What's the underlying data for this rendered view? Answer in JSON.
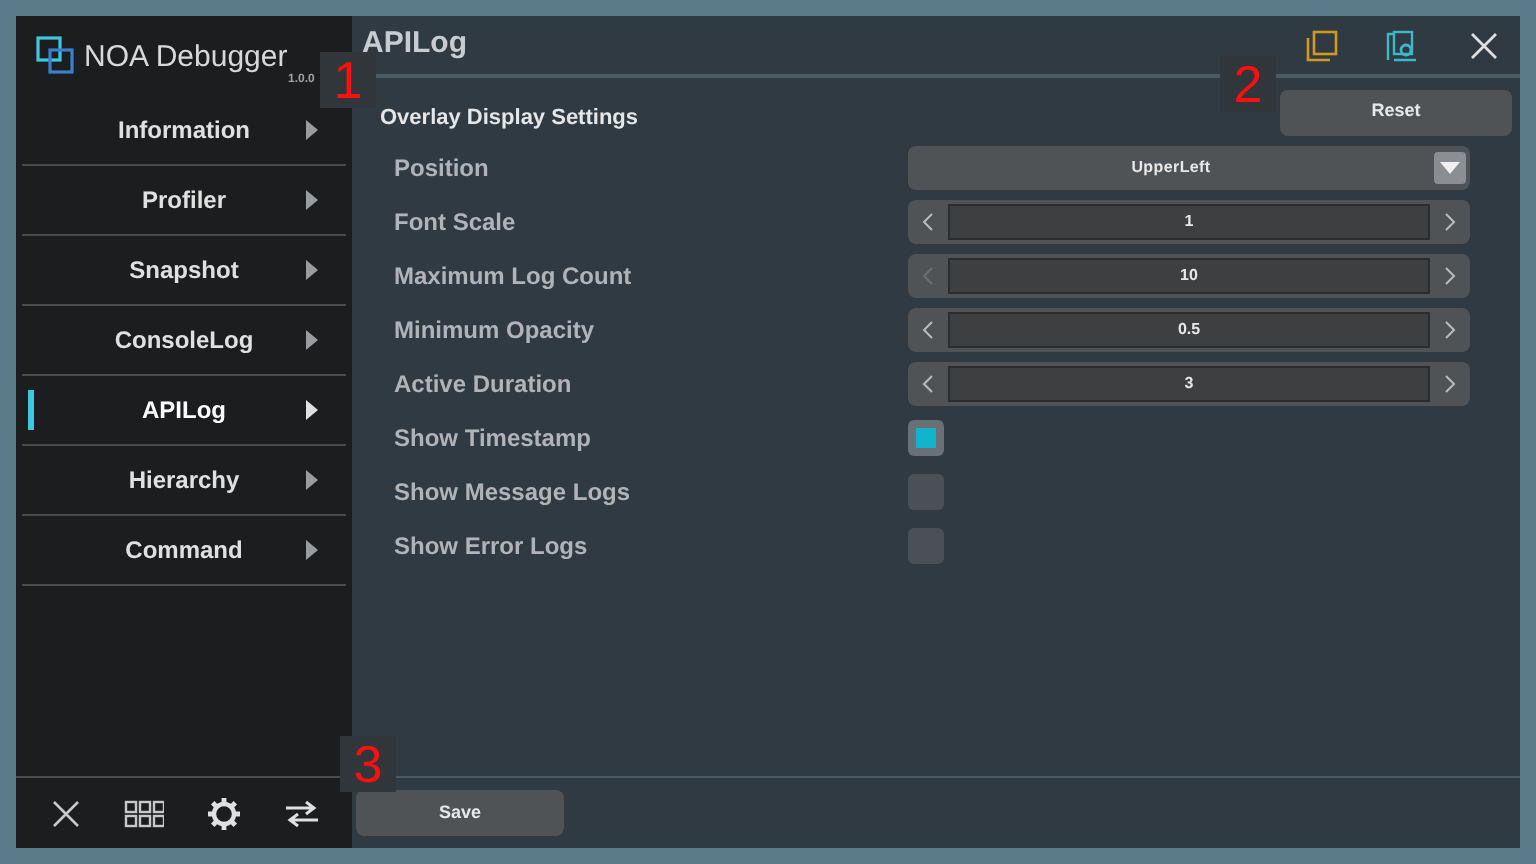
{
  "app": {
    "title": "NOA Debugger",
    "version": "1.0.0"
  },
  "nav": [
    {
      "label": "Information",
      "selected": false
    },
    {
      "label": "Profiler",
      "selected": false
    },
    {
      "label": "Snapshot",
      "selected": false
    },
    {
      "label": "ConsoleLog",
      "selected": false
    },
    {
      "label": "APILog",
      "selected": true
    },
    {
      "label": "Hierarchy",
      "selected": false
    },
    {
      "label": "Command",
      "selected": false
    }
  ],
  "page": {
    "title": "APILog",
    "section": "Overlay Display Settings",
    "reset": "Reset",
    "save": "Save"
  },
  "settings": [
    {
      "kind": "dropdown",
      "label": "Position",
      "value": "UpperLeft"
    },
    {
      "kind": "stepper",
      "label": "Font Scale",
      "value": "1",
      "decrement_enabled": true
    },
    {
      "kind": "stepper",
      "label": "Maximum Log Count",
      "value": "10",
      "decrement_enabled": false
    },
    {
      "kind": "stepper",
      "label": "Minimum Opacity",
      "value": "0.5",
      "decrement_enabled": true
    },
    {
      "kind": "stepper",
      "label": "Active Duration",
      "value": "3",
      "decrement_enabled": true
    },
    {
      "kind": "checkbox",
      "label": "Show Timestamp",
      "checked": true
    },
    {
      "kind": "checkbox",
      "label": "Show Message Logs",
      "checked": false
    },
    {
      "kind": "checkbox",
      "label": "Show Error Logs",
      "checked": false
    }
  ],
  "markers": [
    {
      "label": "1"
    },
    {
      "label": "2"
    },
    {
      "label": "3"
    }
  ]
}
